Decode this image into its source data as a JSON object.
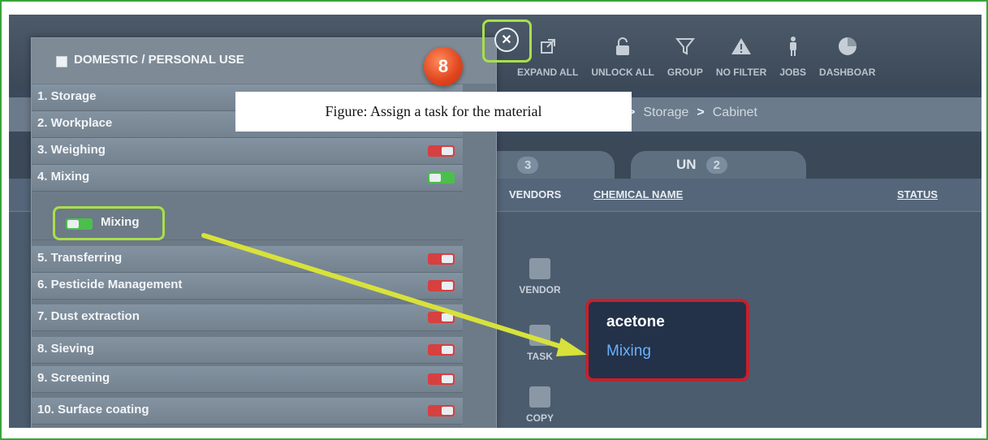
{
  "toolbar": {
    "items": [
      {
        "label": "EXPAND ALL",
        "icon": "external-link-icon"
      },
      {
        "label": "UNLOCK ALL",
        "icon": "unlock-icon"
      },
      {
        "label": "GROUP",
        "icon": "filter-funnel-icon"
      },
      {
        "label": "NO FILTER",
        "icon": "warning-icon"
      },
      {
        "label": "JOBS",
        "icon": "person-icon"
      },
      {
        "label": "DASHBOAR",
        "icon": "pie-chart-icon"
      }
    ]
  },
  "breadcrumb": {
    "items": [
      "Storage",
      "Cabinet"
    ],
    "separator": ">"
  },
  "tabs": [
    {
      "count": "3"
    },
    {
      "label": "UN",
      "count": "2"
    }
  ],
  "columns": {
    "vendors": "VENDORS",
    "chemical_name": "CHEMICAL NAME",
    "status": "STATUS"
  },
  "side_buttons": {
    "vendor": "VENDOR",
    "task": "TASK",
    "copy": "COPY"
  },
  "panel": {
    "header": "DOMESTIC / PERSONAL USE",
    "rows": [
      {
        "label": "1. Storage",
        "enabled": false
      },
      {
        "label": "2. Workplace",
        "enabled": false
      },
      {
        "label": "3. Weighing",
        "enabled": false
      },
      {
        "label": "4. Mixing",
        "enabled": true
      },
      {
        "label": "5. Transferring",
        "enabled": false
      },
      {
        "label": "6. Pesticide Management",
        "enabled": false
      },
      {
        "label": "7. Dust extraction",
        "enabled": false
      },
      {
        "label": "8. Sieving",
        "enabled": false
      },
      {
        "label": "9. Screening",
        "enabled": false
      },
      {
        "label": "10. Surface coating",
        "enabled": false
      }
    ],
    "sub_item": {
      "label": "Mixing",
      "enabled": true
    }
  },
  "step_badge": "8",
  "caption": "Figure: Assign a task for the material",
  "result": {
    "chemical": "acetone",
    "task": "Mixing"
  },
  "colors": {
    "highlight_green": "#a8e04a",
    "badge_orange": "#e0441c",
    "result_border": "#c5212b",
    "task_blue": "#6ab1ff"
  }
}
